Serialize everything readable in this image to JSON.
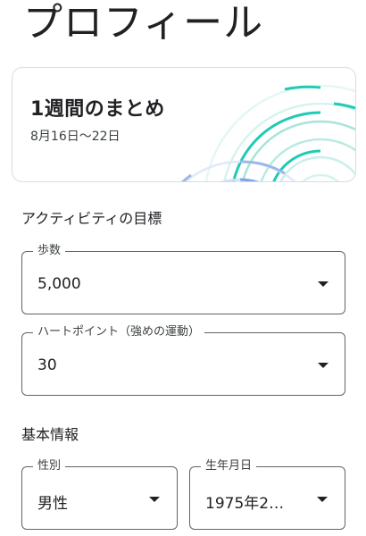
{
  "page": {
    "title": "プロフィール"
  },
  "summary": {
    "title": "1週間のまとめ",
    "date_range": "8月16日～22日"
  },
  "activity_goals": {
    "section_label": "アクティビティの目標",
    "steps": {
      "label": "歩数",
      "value": "5,000"
    },
    "heart_points": {
      "label": "ハートポイント（強めの運動）",
      "value": "30"
    }
  },
  "basic_info": {
    "section_label": "基本情報",
    "gender": {
      "label": "性別",
      "value": "男性"
    },
    "birthdate": {
      "label": "生年月日",
      "value": "1975年2…"
    }
  },
  "icons": {
    "dropdown": "chevron-down-icon"
  },
  "colors": {
    "accent_teal": "#1ecbb4",
    "accent_blue": "#4b7fd6",
    "field_border": "#5f6368",
    "text_primary": "#202124"
  }
}
